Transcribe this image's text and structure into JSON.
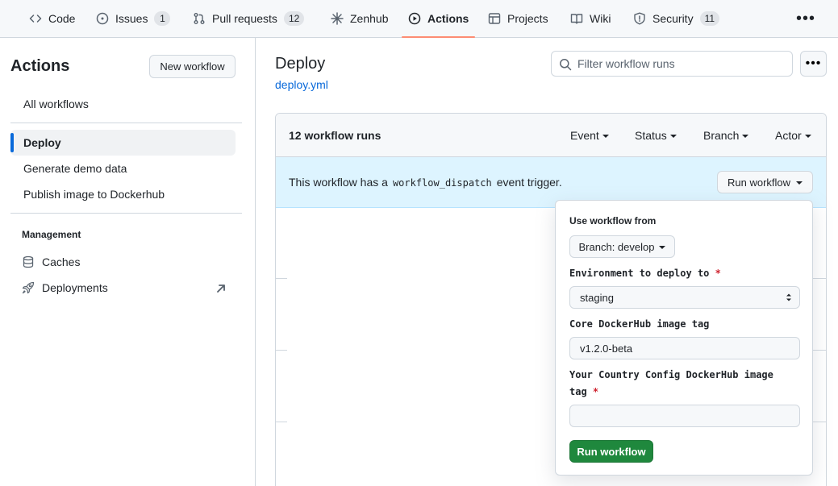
{
  "nav": {
    "tabs": [
      {
        "label": "Code",
        "icon": "code-icon"
      },
      {
        "label": "Issues",
        "icon": "issue-opened-icon",
        "count": "1"
      },
      {
        "label": "Pull requests",
        "icon": "git-pull-request-icon",
        "count": "12"
      },
      {
        "label": "Zenhub",
        "icon": "zenhub-icon"
      },
      {
        "label": "Actions",
        "icon": "play-icon",
        "active": true
      },
      {
        "label": "Projects",
        "icon": "table-icon"
      },
      {
        "label": "Wiki",
        "icon": "book-icon"
      },
      {
        "label": "Security",
        "icon": "shield-icon",
        "count": "11"
      }
    ],
    "more": "•••"
  },
  "sidebar": {
    "title": "Actions",
    "new_workflow": "New workflow",
    "all_workflows": "All workflows",
    "workflows": [
      "Deploy",
      "Generate demo data",
      "Publish image to Dockerhub"
    ],
    "selected": "Deploy",
    "management_label": "Management",
    "management_items": [
      {
        "label": "Caches",
        "icon": "database-icon"
      },
      {
        "label": "Deployments",
        "icon": "rocket-icon",
        "external": true
      }
    ]
  },
  "main": {
    "title": "Deploy",
    "file_link": "deploy.yml",
    "filter_placeholder": "Filter workflow runs",
    "kebab": "•••",
    "runs_count": "12 workflow runs",
    "filters": [
      "Event",
      "Status",
      "Branch",
      "Actor"
    ],
    "dispatch_prefix": "This workflow has a",
    "dispatch_code": "workflow_dispatch",
    "dispatch_suffix": "event trigger.",
    "run_workflow_button": "Run workflow"
  },
  "popover": {
    "use_from_label": "Use workflow from",
    "branch_button": "Branch: develop",
    "env_label": "Environment to deploy to",
    "env_value": "staging",
    "core_tag_label": "Core DockerHub image tag",
    "core_tag_value": "v1.2.0-beta",
    "country_tag_label_line1": "Your Country Config DockerHub image",
    "country_tag_label_line2": "tag",
    "country_tag_value": "",
    "required_mark": "*",
    "submit_button": "Run workflow"
  },
  "colors": {
    "accent_blue": "#0969da",
    "active_tab_underline": "#fd8c73",
    "info_background": "#ddf4ff",
    "primary_green": "#1f883d",
    "required_red": "#cf222e"
  }
}
